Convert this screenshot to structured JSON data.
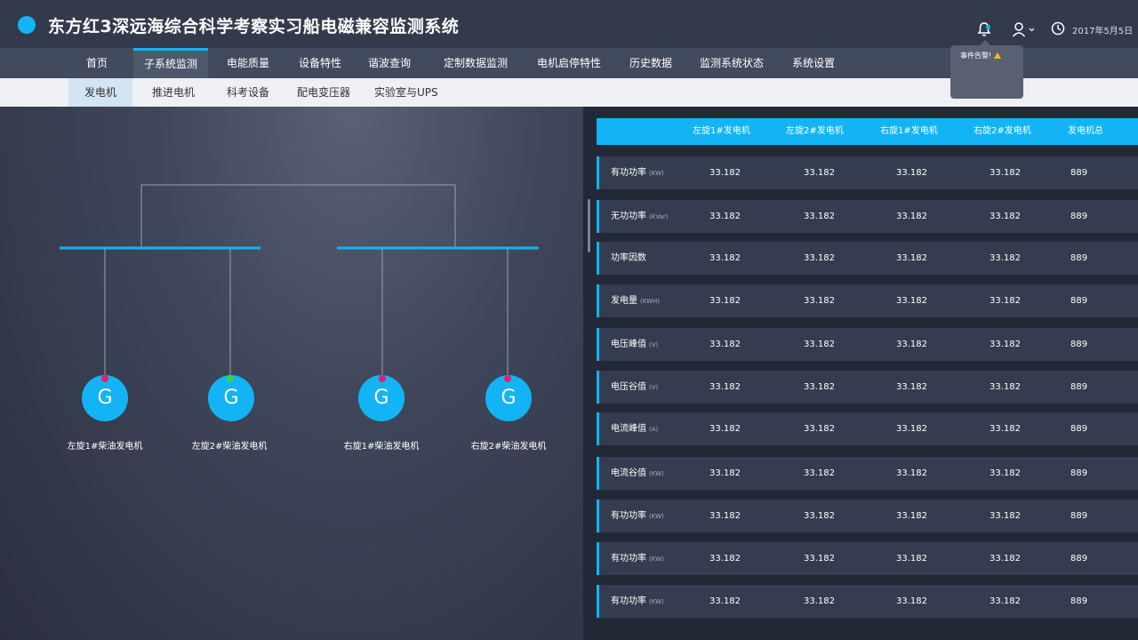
{
  "header": {
    "title": "东方红3深远海综合科学考察实习船电磁兼容监测系统",
    "date": "2017年5月5日",
    "alert": "事件告警!",
    "icons": [
      "bell-icon",
      "user-icon",
      "clock-icon",
      "warning-icon"
    ]
  },
  "nav": [
    "首页",
    "子系统监测",
    "电能质量",
    "设备特性",
    "谐波查询",
    "定制数据监测",
    "电机启停特性",
    "历史数据",
    "监测系统状态",
    "系统设置"
  ],
  "subnav": [
    "发电机",
    "推进电机",
    "科考设备",
    "配电变压器",
    "实验室与UPS"
  ],
  "generators": [
    {
      "label": "左旋1#柴油发电机",
      "symbol": "G",
      "status_color": "#e0206e"
    },
    {
      "label": "左旋2#柴油发电机",
      "symbol": "G",
      "status_color": "#3ad24a"
    },
    {
      "label": "右旋1#柴油发电机",
      "symbol": "G",
      "status_color": "#e0206e"
    },
    {
      "label": "右旋2#柴油发电机",
      "symbol": "G",
      "status_color": "#e0206e"
    }
  ],
  "table": {
    "columns": [
      "左旋1#发电机",
      "左旋2#发电机",
      "右旋1#发电机",
      "右旋2#发电机",
      "发电机总"
    ],
    "rows": [
      {
        "label": "有功功率",
        "unit": "(KW)",
        "values": [
          "33.182",
          "33.182",
          "33.182",
          "33.182",
          "889"
        ]
      },
      {
        "label": "无功功率",
        "unit": "(KVar)",
        "values": [
          "33.182",
          "33.182",
          "33.182",
          "33.182",
          "889"
        ]
      },
      {
        "label": "功率因数",
        "unit": "",
        "values": [
          "33.182",
          "33.182",
          "33.182",
          "33.182",
          "889"
        ]
      },
      {
        "label": "发电量",
        "unit": "(KWH)",
        "values": [
          "33.182",
          "33.182",
          "33.182",
          "33.182",
          "889"
        ]
      },
      {
        "label": "电压峰值",
        "unit": "(V)",
        "values": [
          "33.182",
          "33.182",
          "33.182",
          "33.182",
          "889"
        ]
      },
      {
        "label": "电压谷值",
        "unit": "(V)",
        "values": [
          "33.182",
          "33.182",
          "33.182",
          "33.182",
          "889"
        ]
      },
      {
        "label": "电流峰值",
        "unit": "(A)",
        "values": [
          "33.182",
          "33.182",
          "33.182",
          "33.182",
          "889"
        ]
      },
      {
        "label": "电流谷值",
        "unit": "(KW)",
        "values": [
          "33.182",
          "33.182",
          "33.182",
          "33.182",
          "889"
        ]
      },
      {
        "label": "有功功率",
        "unit": "(KW)",
        "values": [
          "33.182",
          "33.182",
          "33.182",
          "33.182",
          "889"
        ]
      },
      {
        "label": "有功功率",
        "unit": "(KW)",
        "values": [
          "33.182",
          "33.182",
          "33.182",
          "33.182",
          "889"
        ]
      },
      {
        "label": "有功功率",
        "unit": "(KW)",
        "values": [
          "33.182",
          "33.182",
          "33.182",
          "33.182",
          "889"
        ]
      }
    ]
  },
  "colors": {
    "accent": "#12b4f5",
    "bg": "#2a2f3e"
  }
}
